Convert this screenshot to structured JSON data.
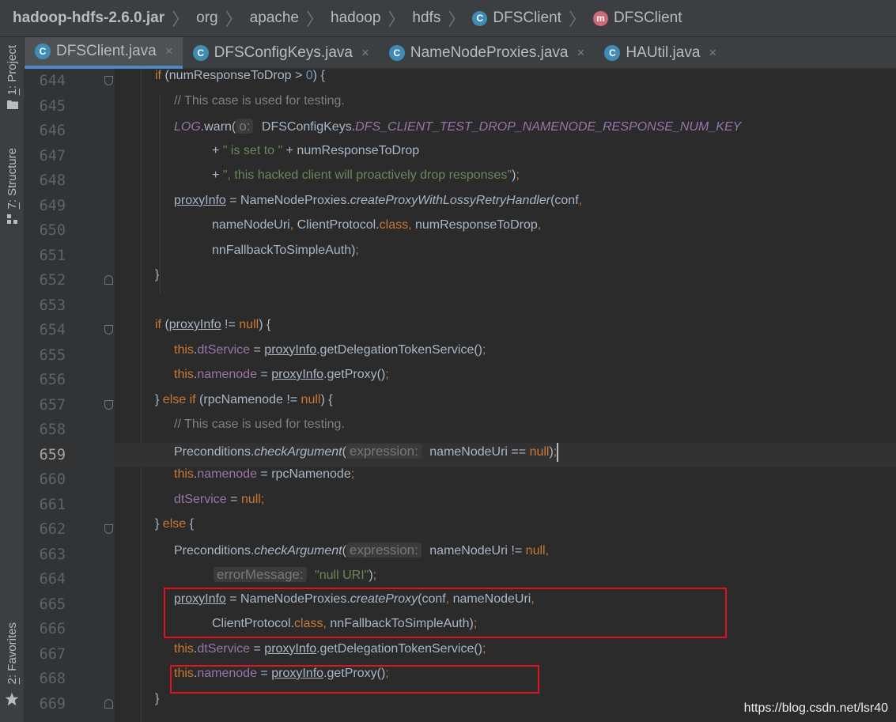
{
  "breadcrumb": {
    "items": [
      "hadoop-hdfs-2.6.0.jar",
      "org",
      "apache",
      "hadoop",
      "hdfs",
      "DFSClient",
      "DFSClient"
    ],
    "class_badge": "C",
    "method_badge": "m"
  },
  "toolwindows": {
    "project_num": "1",
    "project_label": ": Project",
    "structure_num": "7",
    "structure_label": ": Structure",
    "favorites_num": "2",
    "favorites_label": ": Favorites"
  },
  "tabs": [
    {
      "label": "DFSClient.java",
      "active": true
    },
    {
      "label": "DFSConfigKeys.java",
      "active": false
    },
    {
      "label": "NameNodeProxies.java",
      "active": false
    },
    {
      "label": "HAUtil.java",
      "active": false
    }
  ],
  "tab_close": "×",
  "tab_badge": "C",
  "lines": [
    {
      "num": "644",
      "fold": "top"
    },
    {
      "num": "645"
    },
    {
      "num": "646"
    },
    {
      "num": "647"
    },
    {
      "num": "648"
    },
    {
      "num": "649"
    },
    {
      "num": "650"
    },
    {
      "num": "651"
    },
    {
      "num": "652",
      "fold": "bot"
    },
    {
      "num": "653"
    },
    {
      "num": "654",
      "fold": "top"
    },
    {
      "num": "655"
    },
    {
      "num": "656"
    },
    {
      "num": "657",
      "fold": "top"
    },
    {
      "num": "658"
    },
    {
      "num": "659",
      "current": true
    },
    {
      "num": "660"
    },
    {
      "num": "661"
    },
    {
      "num": "662",
      "fold": "top"
    },
    {
      "num": "663"
    },
    {
      "num": "664"
    },
    {
      "num": "665"
    },
    {
      "num": "666"
    },
    {
      "num": "667"
    },
    {
      "num": "668"
    },
    {
      "num": "669",
      "fold": "bot"
    }
  ],
  "code": {
    "l644": {
      "kw": "if",
      "rest1": " (numResponseToDrop > ",
      "num": "0",
      "rest2": ") {"
    },
    "l645": "// This case is used for testing.",
    "l646": {
      "log": "LOG",
      "warn": ".warn(",
      "hint": "o:",
      "cls": " DFSConfigKeys.",
      "const": "DFS_CLIENT_TEST_DROP_NAMENODE_RESPONSE_NUM_KEY"
    },
    "l647": {
      "plus": "+ ",
      "str": "\" is set to \"",
      "rest": " + numResponseToDrop"
    },
    "l648": {
      "plus": "+ ",
      "str": "\", this hacked client will proactively drop responses\"",
      "rest": ")",
      "semi": ";"
    },
    "l649": {
      "var": "proxyInfo",
      "eq": " = NameNodeProxies.",
      "method": "createProxyWithLossyRetryHandler",
      "rest": "(conf",
      "comma": ","
    },
    "l650": {
      "a": "nameNodeUri",
      "c1": ", ",
      "b": "ClientProtocol.",
      "kw": "class",
      "c2": ", ",
      "c": "numResponseToDrop",
      "c3": ","
    },
    "l651": {
      "a": "nnFallbackToSimpleAuth)",
      "semi": ";"
    },
    "l652": "}",
    "l654": {
      "kw": "if",
      "p1": " (",
      "var": "proxyInfo",
      "p2": " != ",
      "null": "null",
      "p3": ") {"
    },
    "l655": {
      "this": "this",
      "dot": ".",
      "fld": "dtService",
      "eq": " = ",
      "var": "proxyInfo",
      "call": ".getDelegationTokenService()",
      "semi": ";"
    },
    "l656": {
      "this": "this",
      "dot": ".",
      "fld": "namenode",
      "eq": " = ",
      "var": "proxyInfo",
      "call": ".getProxy()",
      "semi": ";"
    },
    "l657": {
      "b": "} ",
      "kw": "else if",
      "p1": " (rpcNamenode != ",
      "null": "null",
      "p2": ") {"
    },
    "l658": "// This case is used for testing.",
    "l659": {
      "cls": "Preconditions.",
      "method": "checkArgument",
      "p": "(",
      "hint": "expression:",
      "rest": " nameNodeUri == ",
      "null": "null",
      "end": ")",
      "semi": ";"
    },
    "l660": {
      "this": "this",
      "dot": ".",
      "fld": "namenode",
      "rest": " = rpcNamenode",
      "semi": ";"
    },
    "l661": {
      "fld": "dtService",
      "eq": " = ",
      "null": "null",
      "semi": ";"
    },
    "l662": {
      "b": "} ",
      "kw": "else",
      "p": " {"
    },
    "l663": {
      "cls": "Preconditions.",
      "method": "checkArgument",
      "p": "(",
      "hint": "expression:",
      "rest": " nameNodeUri != ",
      "null": "null",
      "comma": ","
    },
    "l664": {
      "hint": "errorMessage:",
      "str": " \"null URI\"",
      "end": ")",
      "semi": ";"
    },
    "l665": {
      "var": "proxyInfo",
      "eq": " = NameNodeProxies.",
      "method": "createProxy",
      "p": "(conf",
      "c1": ", ",
      "a": "nameNodeUri",
      "c2": ","
    },
    "l666": {
      "b": "ClientProtocol.",
      "kw": "class",
      "c1": ", ",
      "a": "nnFallbackToSimpleAuth)",
      "semi": ";"
    },
    "l667": {
      "this": "this",
      "dot": ".",
      "fld": "dtService",
      "eq": " = ",
      "var": "proxyInfo",
      "call": ".getDelegationTokenService()",
      "semi": ";"
    },
    "l668": {
      "this": "this",
      "dot": ".",
      "fld": "namenode",
      "eq": " = ",
      "var": "proxyInfo",
      "call": ".getProxy()",
      "semi": ";"
    },
    "l669": "}"
  },
  "watermark": "https://blog.csdn.net/lsr40",
  "colors": {
    "keyword": "#cc7832",
    "string": "#6a8759",
    "field": "#9876aa",
    "number": "#6897bb",
    "comment": "#808080",
    "highlight_box": "#e0121f"
  }
}
